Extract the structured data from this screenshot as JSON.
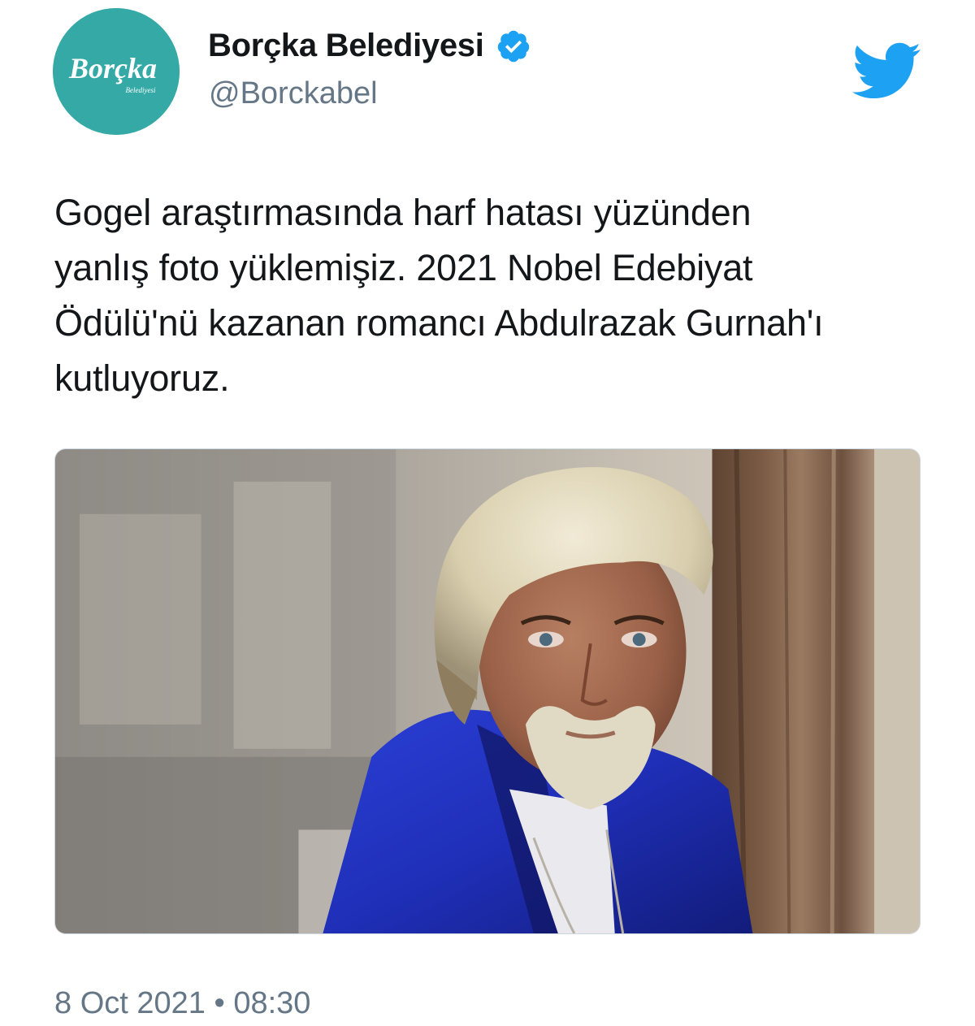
{
  "account": {
    "display_name": "Borçka Belediyesi",
    "handle": "@Borckabel",
    "verified": true,
    "avatar": {
      "logo_text": "Borçka",
      "logo_subtext": "Belediyesi",
      "background_color": "#34a9a6"
    }
  },
  "tweet": {
    "text": "Gogel araştırmasında harf hatası yüzünden\nyanlış foto yüklemişiz. 2021 Nobel Edebiyat\nÖdülü'nü kazanan romancı Abdulrazak Gurnah'ı\nkutluyoruz.",
    "timestamp": "8 Oct 2021 • 08:30"
  },
  "media": {
    "type": "photo",
    "description_icon": "photo-man-blue-jacket"
  },
  "icons": {
    "verified": "verified-badge-icon",
    "twitter": "twitter-bird-icon"
  },
  "colors": {
    "twitter_blue": "#1da1f2",
    "secondary_text": "#657786",
    "primary_text": "#14171a"
  }
}
